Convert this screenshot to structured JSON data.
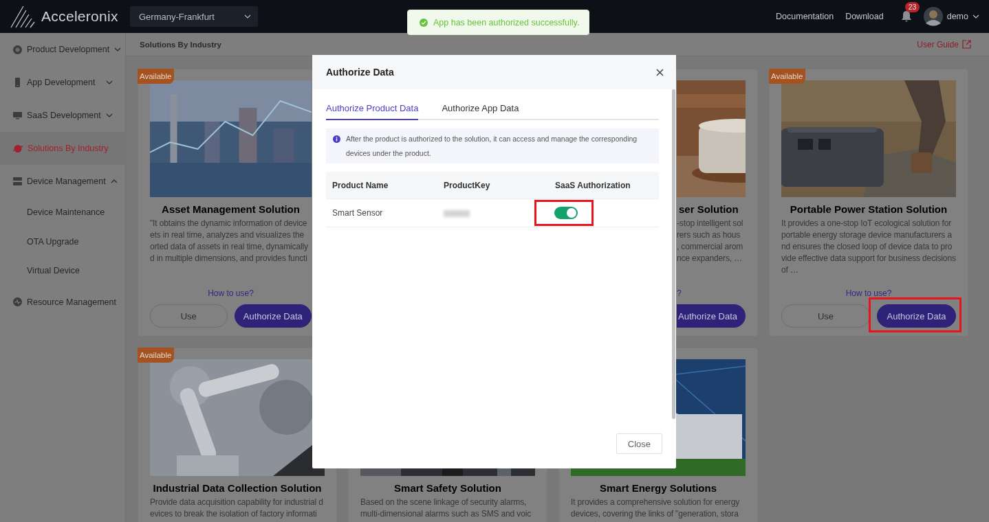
{
  "header": {
    "logo": "Acceleronix",
    "region": "Germany-Frankfurt",
    "links": [
      "Documentation",
      "Download"
    ],
    "notifications": "23",
    "user": "demo"
  },
  "toast": {
    "kind": "success",
    "message": "App has been authorized successfully."
  },
  "sidebar": {
    "items": [
      {
        "kind": "group",
        "label": "Product Development",
        "selected": false,
        "expanded": false
      },
      {
        "kind": "group",
        "label": "App Development",
        "selected": false,
        "expanded": false
      },
      {
        "kind": "group",
        "label": "SaaS Development",
        "selected": false,
        "expanded": false
      },
      {
        "kind": "link",
        "label": "Solutions By Industry",
        "selected": true
      },
      {
        "kind": "group",
        "label": "Device Management",
        "selected": false,
        "expanded": true,
        "children": [
          {
            "label": "Device Maintenance",
            "selected": false
          },
          {
            "label": "OTA Upgrade",
            "selected": false
          },
          {
            "label": "Virtual Device",
            "selected": false
          }
        ]
      },
      {
        "kind": "link",
        "label": "Resource Management",
        "selected": false
      }
    ]
  },
  "breadcrumb": "Solutions By Industry",
  "user_guide": "User Guide",
  "cards": [
    {
      "kind": "covered_right",
      "badge": "Available",
      "title": "Asset Management Solution",
      "description_lines": [
        "\"It obtains the dynamic information of device",
        "ets in real time, analyzes and visualizes the",
        "orted data of assets in real time, dynamically",
        "d in multiple dimensions, and provides functi"
      ],
      "how_to": "How to use?",
      "buttons": [
        {
          "label": "Use",
          "kind": "default",
          "highlighted": false
        },
        {
          "label": "Authorize Data",
          "kind": "primary",
          "highlighted": false
        }
      ]
    },
    {
      "kind": "covered_left",
      "title": "ser Solution",
      "description_lines": [
        "-stop intelligent sol",
        "rers such as hous",
        ", commercial arom",
        "nce expanders, …"
      ],
      "how_to": "?",
      "buttons": [
        {
          "label": "Authorize Data",
          "kind": "primary",
          "highlighted": false
        }
      ]
    },
    {
      "kind": "full",
      "badge": "Available",
      "title": "Portable Power Station Solution",
      "description": "It provides a one-stop IoT ecological solution for portable energy storage device manufacturers and ensures the closed loop of device data to provide effective data support for business decisions of …",
      "how_to": "How to use?",
      "buttons": [
        {
          "label": "Use",
          "kind": "default",
          "highlighted": false
        },
        {
          "label": "Authorize Data",
          "kind": "primary",
          "highlighted": true
        }
      ]
    },
    {
      "kind": "full",
      "badge": "Available",
      "title": "Industrial Data Collection Solution",
      "description": "Provide data acquisition capability for industrial devices to break the isolation of factory informati"
    },
    {
      "kind": "full",
      "title": "Smart Safety Solution",
      "description": "Based on the scene linkage of security alarms, multi-dimensional alarms such as SMS and voic"
    },
    {
      "kind": "full",
      "title": "Smart Energy Solutions",
      "description": "It provides a comprehensive solution for energy devices, covering the links of \"generation, stora"
    }
  ],
  "modal": {
    "title": "Authorize Data",
    "tabs": [
      {
        "label": "Authorize Product Data",
        "selected": true
      },
      {
        "label": "Authorize App Data",
        "selected": false
      }
    ],
    "notice": "After the product is authorized to the solution, it can access and manage the corresponding devices under the product.",
    "table": {
      "columns": [
        "Product Name",
        "ProductKey",
        "SaaS Authorization"
      ],
      "rows": [
        {
          "product_name": "Smart Sensor",
          "key_masked": true,
          "authorized": true,
          "highlighted": true
        }
      ]
    },
    "buttons": [
      "Close"
    ]
  }
}
